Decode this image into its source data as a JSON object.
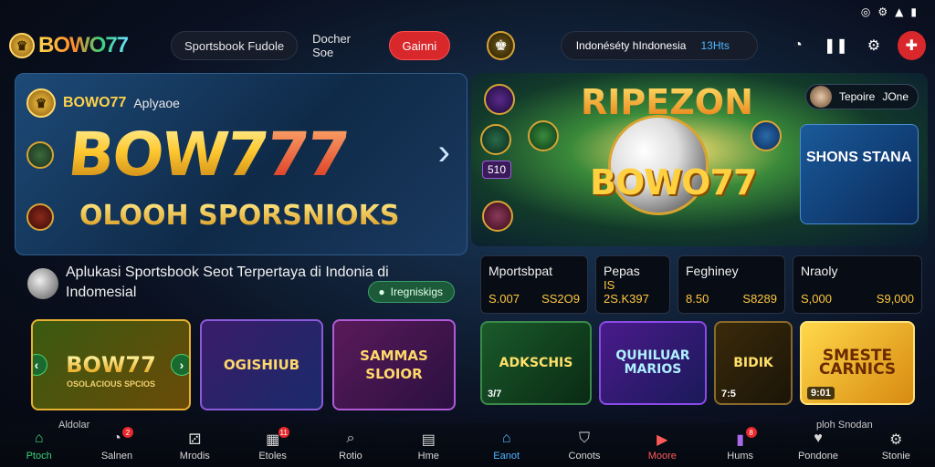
{
  "status": {
    "icons": [
      "wifi-icon",
      "settings-icon",
      "signal-icon",
      "battery-icon"
    ]
  },
  "header": {
    "logo_text": "BOWO77",
    "nav": [
      "Sportsbook Fudole",
      "Docher Soe"
    ],
    "cta": "Gainni",
    "search_text": "Indonéséty hIndonesia",
    "search_count": "13Hts"
  },
  "hero": {
    "sub_brand": "BOWO77",
    "sub_app": "Aplyaoe",
    "big_title": "BOW7",
    "big_num": "77",
    "tagline": "OLOOH SPORSNIOKS"
  },
  "info": {
    "text": "Aplukasi Sportsbook Seot Terpertaya di Indonia di Indomesial",
    "chip": "Iregniskigs"
  },
  "left_games": [
    {
      "title": "BOW77",
      "sub": "OSOLACIOUS SPCIOS"
    },
    {
      "title": "OGISHIUB"
    },
    {
      "title": "SAMMAS SLOIOR"
    }
  ],
  "right_hero": {
    "title": "RIPEZON",
    "brand": "BOWO",
    "brand_num": "77",
    "user": "Tepoire",
    "user_value": "JOne",
    "promo": "SHONS STANA",
    "score": "510"
  },
  "stats": [
    {
      "title": "Mportsbpat",
      "a": "S.007",
      "b": "SS2O9"
    },
    {
      "title": "Pepas",
      "a": "IS 2S.K397",
      "b": ""
    },
    {
      "title": "Feghiney",
      "a": "8.50",
      "b": "S8289"
    },
    {
      "title": "Nraoly",
      "a": "S,000",
      "b": "S9,000"
    }
  ],
  "right_games": [
    {
      "title": "ADKSCHIS",
      "corner": "3/7"
    },
    {
      "title": "QUHILUAR MARIOS",
      "corner": ""
    },
    {
      "title": "BIDIK",
      "corner": "7:5"
    },
    {
      "title": "SMESTE CARNICS",
      "corner": "9:01"
    }
  ],
  "bottom_left": [
    {
      "label": "Ptoch",
      "icon": "home-icon",
      "badge": ""
    },
    {
      "label": "Salnen",
      "icon": "chat-icon",
      "badge": "2"
    },
    {
      "label": "Mrodis",
      "icon": "gamepad-icon",
      "badge": ""
    },
    {
      "label": "Etoles",
      "icon": "calendar-icon",
      "badge": "11"
    },
    {
      "label": "Rotio",
      "icon": "search-icon",
      "badge": ""
    },
    {
      "label": "Hme",
      "icon": "document-icon",
      "badge": ""
    }
  ],
  "bottom_right": [
    {
      "label": "Eanot",
      "icon": "home-icon",
      "badge": ""
    },
    {
      "label": "Conots",
      "icon": "shield-icon",
      "badge": ""
    },
    {
      "label": "Moore",
      "icon": "play-icon",
      "badge": ""
    },
    {
      "label": "Hums",
      "icon": "bookmark-icon",
      "badge": "8"
    },
    {
      "label": "Pondone",
      "icon": "heart-icon",
      "badge": ""
    },
    {
      "label": "Stonie",
      "icon": "gear-icon",
      "badge": ""
    }
  ],
  "nav_hints": {
    "left": "Aldolar",
    "right": "ploh Snodan"
  }
}
